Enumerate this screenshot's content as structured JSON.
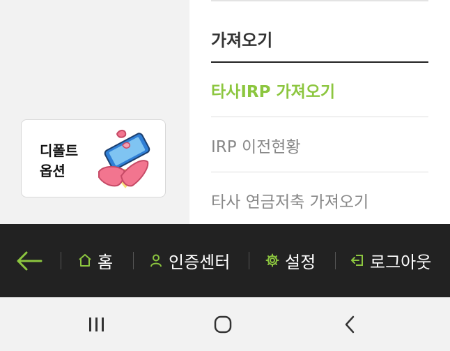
{
  "menu": {
    "section_title": "가져오기",
    "items": [
      {
        "label": "타사IRP 가져오기",
        "active": true
      },
      {
        "label": "IRP 이전현황",
        "active": false
      },
      {
        "label": "타사 연금저축 가져오기",
        "active": false
      }
    ]
  },
  "option_card": {
    "line1": "디폴트",
    "line2": "옵션"
  },
  "bottom_nav": {
    "home_label": "홈",
    "cert_label": "인증센터",
    "settings_label": "설정",
    "logout_label": "로그아웃"
  },
  "colors": {
    "accent": "#8cc63f",
    "nav_bg": "#222222",
    "panel_bg": "#f2f2f2"
  },
  "icons": [
    "back-arrow-icon",
    "home-icon",
    "person-icon",
    "gear-icon",
    "logout-icon",
    "recent-apps-icon",
    "home-circle-icon",
    "back-chevron-icon"
  ]
}
